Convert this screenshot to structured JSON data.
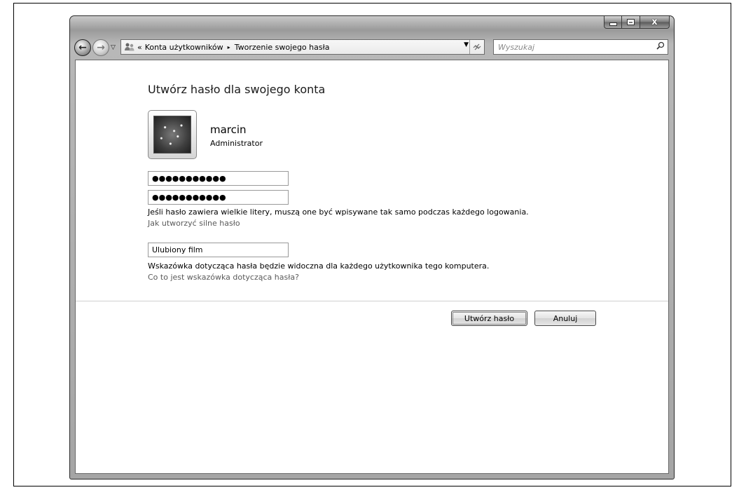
{
  "window": {
    "caption": {
      "minimize": "–",
      "maximize": "□",
      "close": "x"
    }
  },
  "nav": {
    "back_icon": "back-arrow-icon",
    "forward_icon": "forward-arrow-icon",
    "address": {
      "icon": "users-icon",
      "overflow": "«",
      "crumbs": [
        "Konta użytkowników",
        "Tworzenie swojego hasła"
      ],
      "separator": "▸",
      "refresh": "⁴⁄"
    },
    "search": {
      "placeholder": "Wyszukaj"
    }
  },
  "page": {
    "heading": "Utwórz hasło dla swojego konta",
    "user": {
      "name": "marcin",
      "role": "Administrator"
    },
    "password_1": "●●●●●●●●●●●",
    "password_2": "●●●●●●●●●●●",
    "caps_note": "Jeśli hasło zawiera wielkie litery, muszą one być wpisywane tak samo podczas każdego logowania.",
    "strong_link": "Jak utworzyć silne hasło",
    "hint_value": "Ulubiony film",
    "hint_note": "Wskazówka dotycząca hasła będzie widoczna dla każdego użytkownika tego komputera.",
    "hint_link": "Co to jest wskazówka dotycząca hasła?"
  },
  "buttons": {
    "create": "Utwórz hasło",
    "cancel": "Anuluj"
  }
}
